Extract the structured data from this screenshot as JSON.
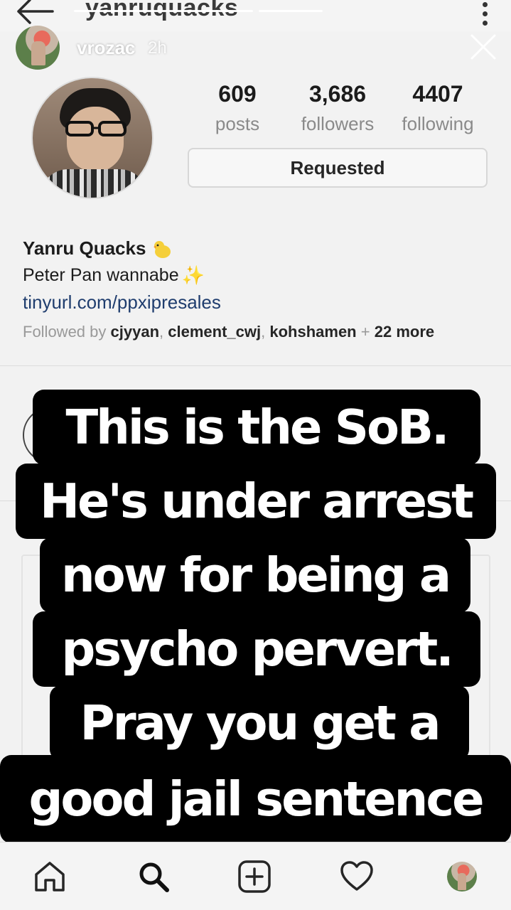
{
  "profile": {
    "username": "yanruquacks",
    "display_name": "Yanru Quacks",
    "bio": "Peter Pan wannabe",
    "link": "tinyurl.com/ppxipresales",
    "stats": {
      "posts": {
        "value": "609",
        "label": "posts"
      },
      "followers": {
        "value": "3,686",
        "label": "followers"
      },
      "following": {
        "value": "4407",
        "label": "following"
      }
    },
    "follow_button": "Requested",
    "followed_by": {
      "prefix": "Followed by",
      "users": [
        "cjyyan",
        "clement_cwj",
        "kohshamen"
      ],
      "separator": ",",
      "more": "22 more",
      "plus": "+"
    }
  },
  "story": {
    "user": "vrozac",
    "time": "2h",
    "progress": [
      1.0,
      0.35
    ]
  },
  "caption": {
    "lines": [
      "This is the SoB.",
      "He's under arrest",
      "now for being a",
      "psycho pervert.",
      "Pray you get a",
      "good jail sentence"
    ]
  },
  "icons": {
    "back": "back-arrow-icon",
    "menu": "more-vertical-icon",
    "close": "close-icon",
    "chick": "baby-chick-icon",
    "sparkles": "sparkles-icon",
    "nav": [
      "home-icon",
      "search-icon",
      "new-post-icon",
      "heart-icon",
      "profile-avatar-icon"
    ]
  },
  "colors": {
    "link": "#1f3d6e",
    "caption_bg": "#000000",
    "caption_text": "#ffffff",
    "muted_text": "#8a8a8a"
  }
}
